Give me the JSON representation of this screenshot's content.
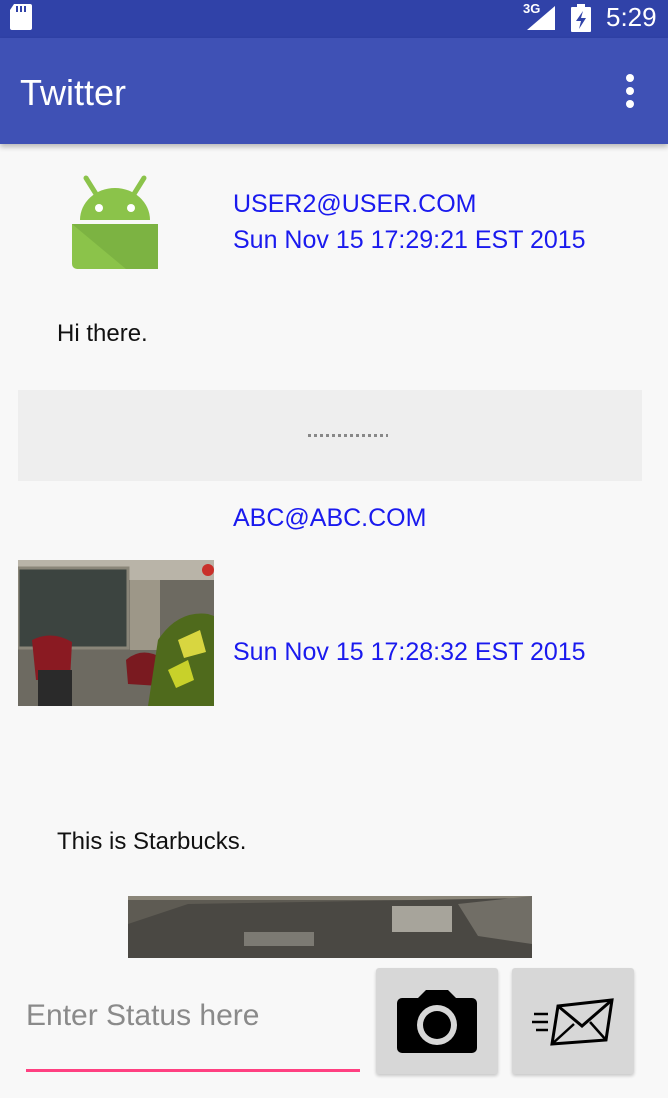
{
  "status_bar": {
    "network": "3G",
    "time": "5:29",
    "icons": [
      "sd-card-icon",
      "signal-icon",
      "battery-icon"
    ]
  },
  "app_bar": {
    "title": "Twitter",
    "menu_icon": "overflow-menu-icon",
    "background": "#3f51b5"
  },
  "feed": {
    "posts": [
      {
        "avatar": "android-icon",
        "user": "USER2@USER.COM",
        "date": "Sun Nov 15 17:29:21 EST 2015",
        "text": "Hi there."
      },
      {
        "avatar": "classroom-photo",
        "user": "ABC@ABC.COM",
        "date": "Sun Nov 15 17:28:32 EST 2015",
        "text": "This is Starbucks."
      }
    ]
  },
  "compose": {
    "placeholder": "Enter Status here",
    "value": "",
    "camera_icon": "camera-icon",
    "send_icon": "send-mail-icon",
    "accent": "#ff4081"
  }
}
